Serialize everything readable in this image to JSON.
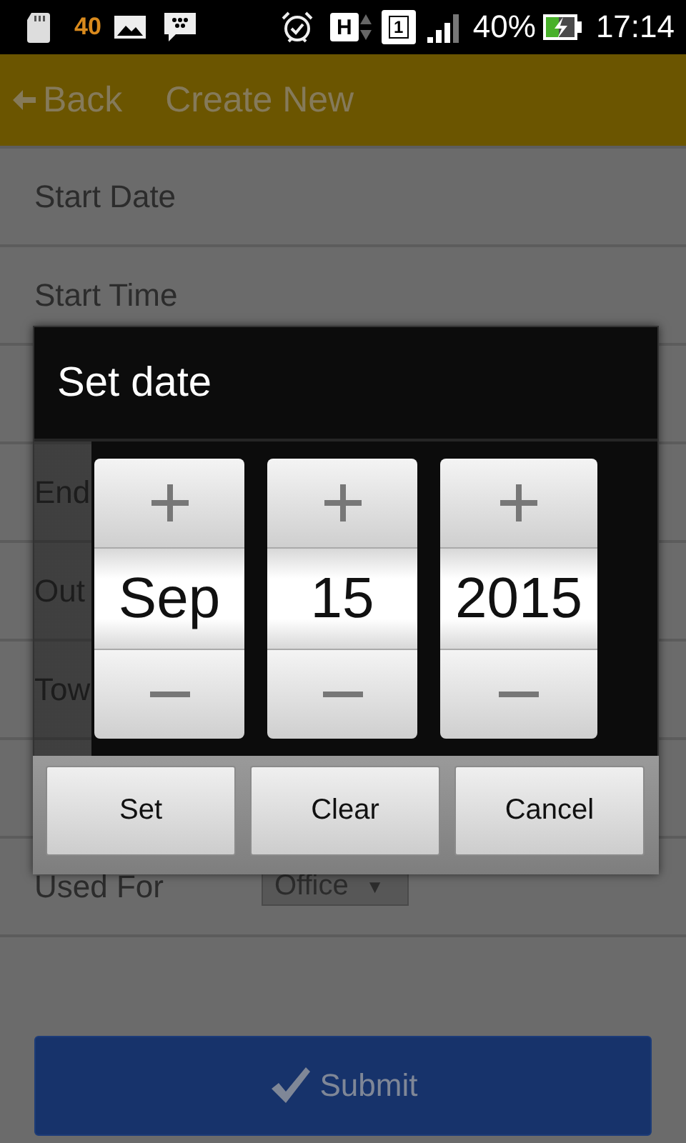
{
  "status_bar": {
    "notification_count": "40",
    "network_type": "H",
    "sim_slot": "1",
    "battery": "40%",
    "charging": true,
    "time": "17:14"
  },
  "app_bar": {
    "back": "Back",
    "title": "Create New"
  },
  "form": {
    "rows": [
      {
        "kind": "text",
        "label": "Start Date"
      },
      {
        "kind": "text",
        "label": "Start Time"
      },
      {
        "kind": "covered"
      },
      {
        "kind": "text",
        "label": "End"
      },
      {
        "kind": "text",
        "label": "Out"
      },
      {
        "kind": "text",
        "label": "Tow"
      },
      {
        "kind": "covered"
      },
      {
        "kind": "select",
        "label": "Used For",
        "value": "Office",
        "caret": "▼"
      }
    ]
  },
  "dialog": {
    "title": "Set date",
    "pickers": [
      {
        "value": "Sep"
      },
      {
        "value": "15"
      },
      {
        "value": "2015"
      }
    ],
    "buttons": [
      "Set",
      "Clear",
      "Cancel"
    ]
  },
  "submit": {
    "label": "Submit"
  }
}
